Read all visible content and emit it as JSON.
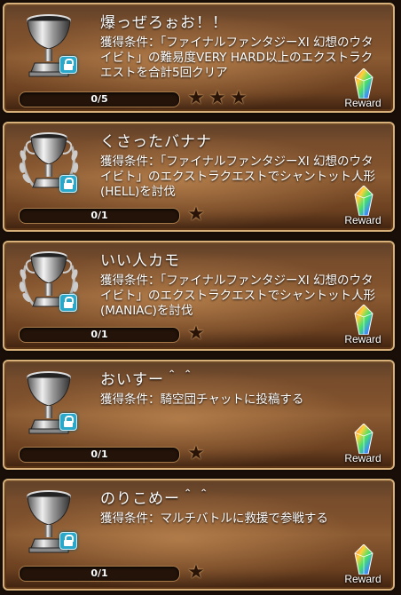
{
  "achievements": [
    {
      "title": "爆っぜろぉお！！",
      "condition": "獲得条件：「ファイナルファンタジーXI 幻想のウタイビト」の難易度VERY HARD以上のエクストラクエストを合計5回クリア",
      "progress": "0/5",
      "progress_value": 0,
      "stars": 3,
      "reward_label": "Reward",
      "trophy": "silver-cup"
    },
    {
      "title": "くさったバナナ",
      "condition": "獲得条件：「ファイナルファンタジーXI 幻想のウタイビト」のエクストラクエストでシャントット人形(HELL)を討伐",
      "progress": "0/1",
      "progress_value": 0,
      "stars": 1,
      "reward_label": "Reward",
      "trophy": "laurel-cup"
    },
    {
      "title": "いい人カモ",
      "condition": "獲得条件：「ファイナルファンタジーXI 幻想のウタイビト」のエクストラクエストでシャントット人形(MANIAC)を討伐",
      "progress": "0/1",
      "progress_value": 0,
      "stars": 1,
      "reward_label": "Reward",
      "trophy": "laurel-cup"
    },
    {
      "title": "おいすー＾＾",
      "condition": "獲得条件：騎空団チャットに投稿する",
      "progress": "0/1",
      "progress_value": 0,
      "stars": 1,
      "reward_label": "Reward",
      "trophy": "silver-cup"
    },
    {
      "title": "のりこめー＾＾",
      "condition": "獲得条件：マルチバトルに救援で参戦する",
      "progress": "0/1",
      "progress_value": 0,
      "stars": 1,
      "reward_label": "Reward",
      "trophy": "silver-cup"
    }
  ]
}
